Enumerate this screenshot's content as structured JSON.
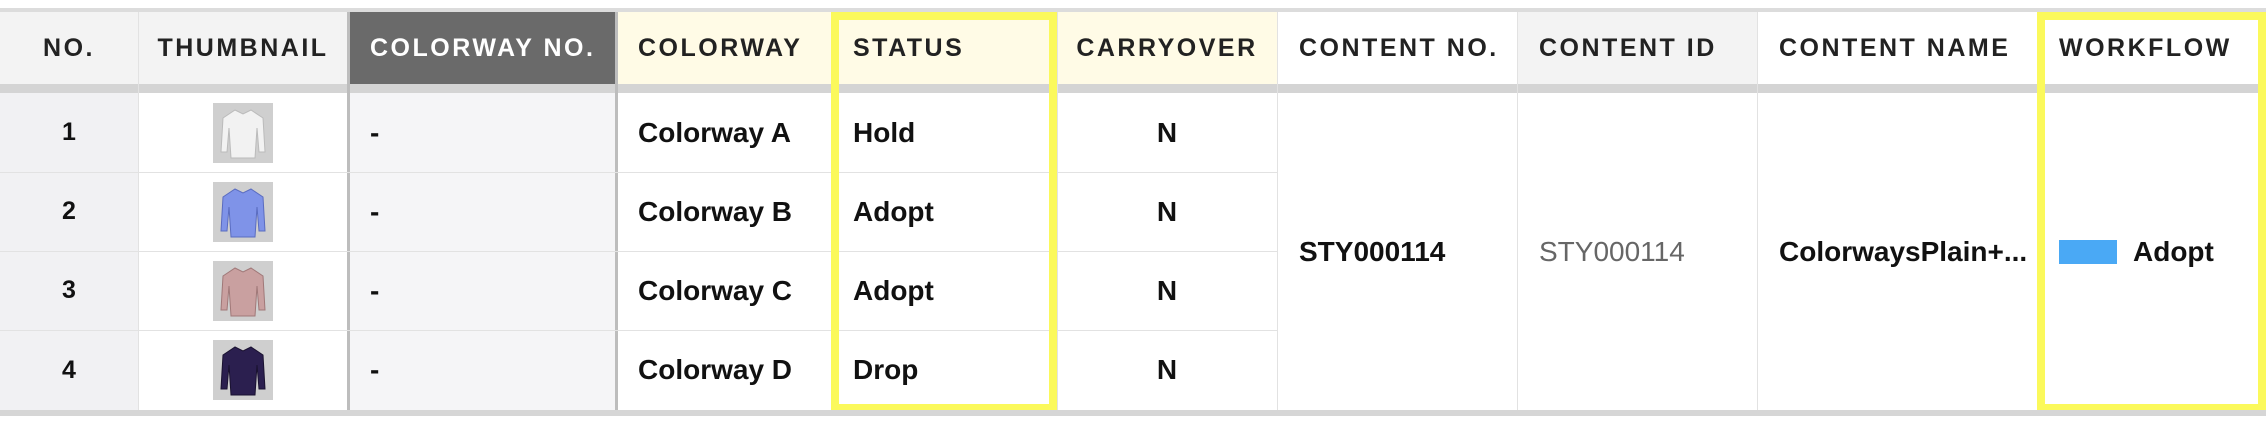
{
  "columns": {
    "no": "NO.",
    "thumbnail": "THUMBNAIL",
    "colorway_no": "COLORWAY NO.",
    "colorway": "COLORWAY",
    "status": "STATUS",
    "carryover": "CARRYOVER",
    "content_no": "CONTENT NO.",
    "content_id": "CONTENT ID",
    "content_name": "CONTENT NAME",
    "workflow": "WORKFLOW"
  },
  "rows": [
    {
      "no": "1",
      "thumbnail_icon": "shirt-white-icon",
      "thumbnail_color": "#f2f2f2",
      "colorway_no": "-",
      "colorway": "Colorway A",
      "status": "Hold",
      "carryover": "N"
    },
    {
      "no": "2",
      "thumbnail_icon": "shirt-blue-icon",
      "thumbnail_color": "#7f93e8",
      "colorway_no": "-",
      "colorway": "Colorway B",
      "status": "Adopt",
      "carryover": "N"
    },
    {
      "no": "3",
      "thumbnail_icon": "shirt-pink-icon",
      "thumbnail_color": "#c9a0a0",
      "colorway_no": "-",
      "colorway": "Colorway C",
      "status": "Adopt",
      "carryover": "N"
    },
    {
      "no": "4",
      "thumbnail_icon": "shirt-navy-icon",
      "thumbnail_color": "#2b1f4f",
      "colorway_no": "-",
      "colorway": "Colorway D",
      "status": "Drop",
      "carryover": "N"
    }
  ],
  "group": {
    "content_no": "STY000114",
    "content_id": "STY000114",
    "content_name": "ColorwaysPlain+...",
    "workflow_label": "Adopt",
    "workflow_color": "#4aa9f5"
  },
  "highlight_color": "#fbf95b"
}
